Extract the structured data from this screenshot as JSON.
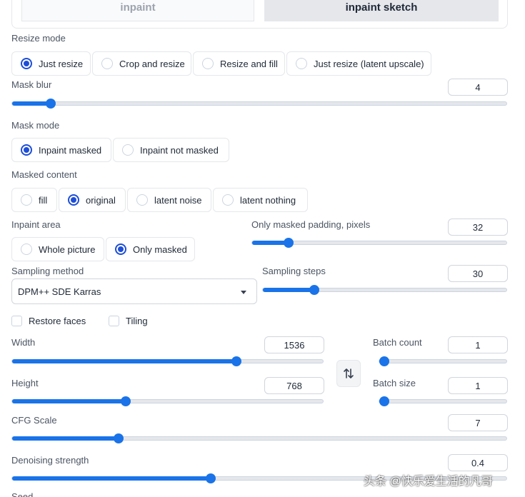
{
  "tabs": {
    "inpaint": "inpaint",
    "inpaint_sketch": "inpaint sketch"
  },
  "resize_mode": {
    "label": "Resize mode",
    "options": [
      "Just resize",
      "Crop and resize",
      "Resize and fill",
      "Just resize (latent upscale)"
    ],
    "selected": "Just resize"
  },
  "mask_blur": {
    "label": "Mask blur",
    "value": "4",
    "fraction": 0.07
  },
  "mask_mode": {
    "label": "Mask mode",
    "options": [
      "Inpaint masked",
      "Inpaint not masked"
    ],
    "selected": "Inpaint masked"
  },
  "masked_content": {
    "label": "Masked content",
    "options": [
      "fill",
      "original",
      "latent noise",
      "latent nothing"
    ],
    "selected": "original"
  },
  "inpaint_area": {
    "label": "Inpaint area",
    "options": [
      "Whole picture",
      "Only masked"
    ],
    "selected": "Only masked"
  },
  "only_masked_padding": {
    "label": "Only masked padding, pixels",
    "value": "32",
    "fraction": 0.13
  },
  "sampling_method": {
    "label": "Sampling method",
    "value": "DPM++ SDE Karras"
  },
  "sampling_steps": {
    "label": "Sampling steps",
    "value": "30",
    "fraction": 0.2
  },
  "checkboxes": {
    "restore_faces": "Restore faces",
    "tiling": "Tiling"
  },
  "width": {
    "label": "Width",
    "value": "1536",
    "fraction": 0.73
  },
  "height": {
    "label": "Height",
    "value": "768",
    "fraction": 0.36
  },
  "batch_count": {
    "label": "Batch count",
    "value": "1",
    "fraction": 0.0
  },
  "batch_size": {
    "label": "Batch size",
    "value": "1",
    "fraction": 0.0
  },
  "cfg_scale": {
    "label": "CFG Scale",
    "value": "7",
    "fraction": 0.21
  },
  "denoising_strength": {
    "label": "Denoising strength",
    "value": "0.4",
    "fraction": 0.4
  },
  "seed": {
    "label": "Seed"
  },
  "icons": {
    "swap": "swap-arrows-icon",
    "dropdown": "chevron-down-icon"
  },
  "colors": {
    "accent": "#1a73e8"
  },
  "watermark": "头条 @快乐爱生活的凡哥"
}
